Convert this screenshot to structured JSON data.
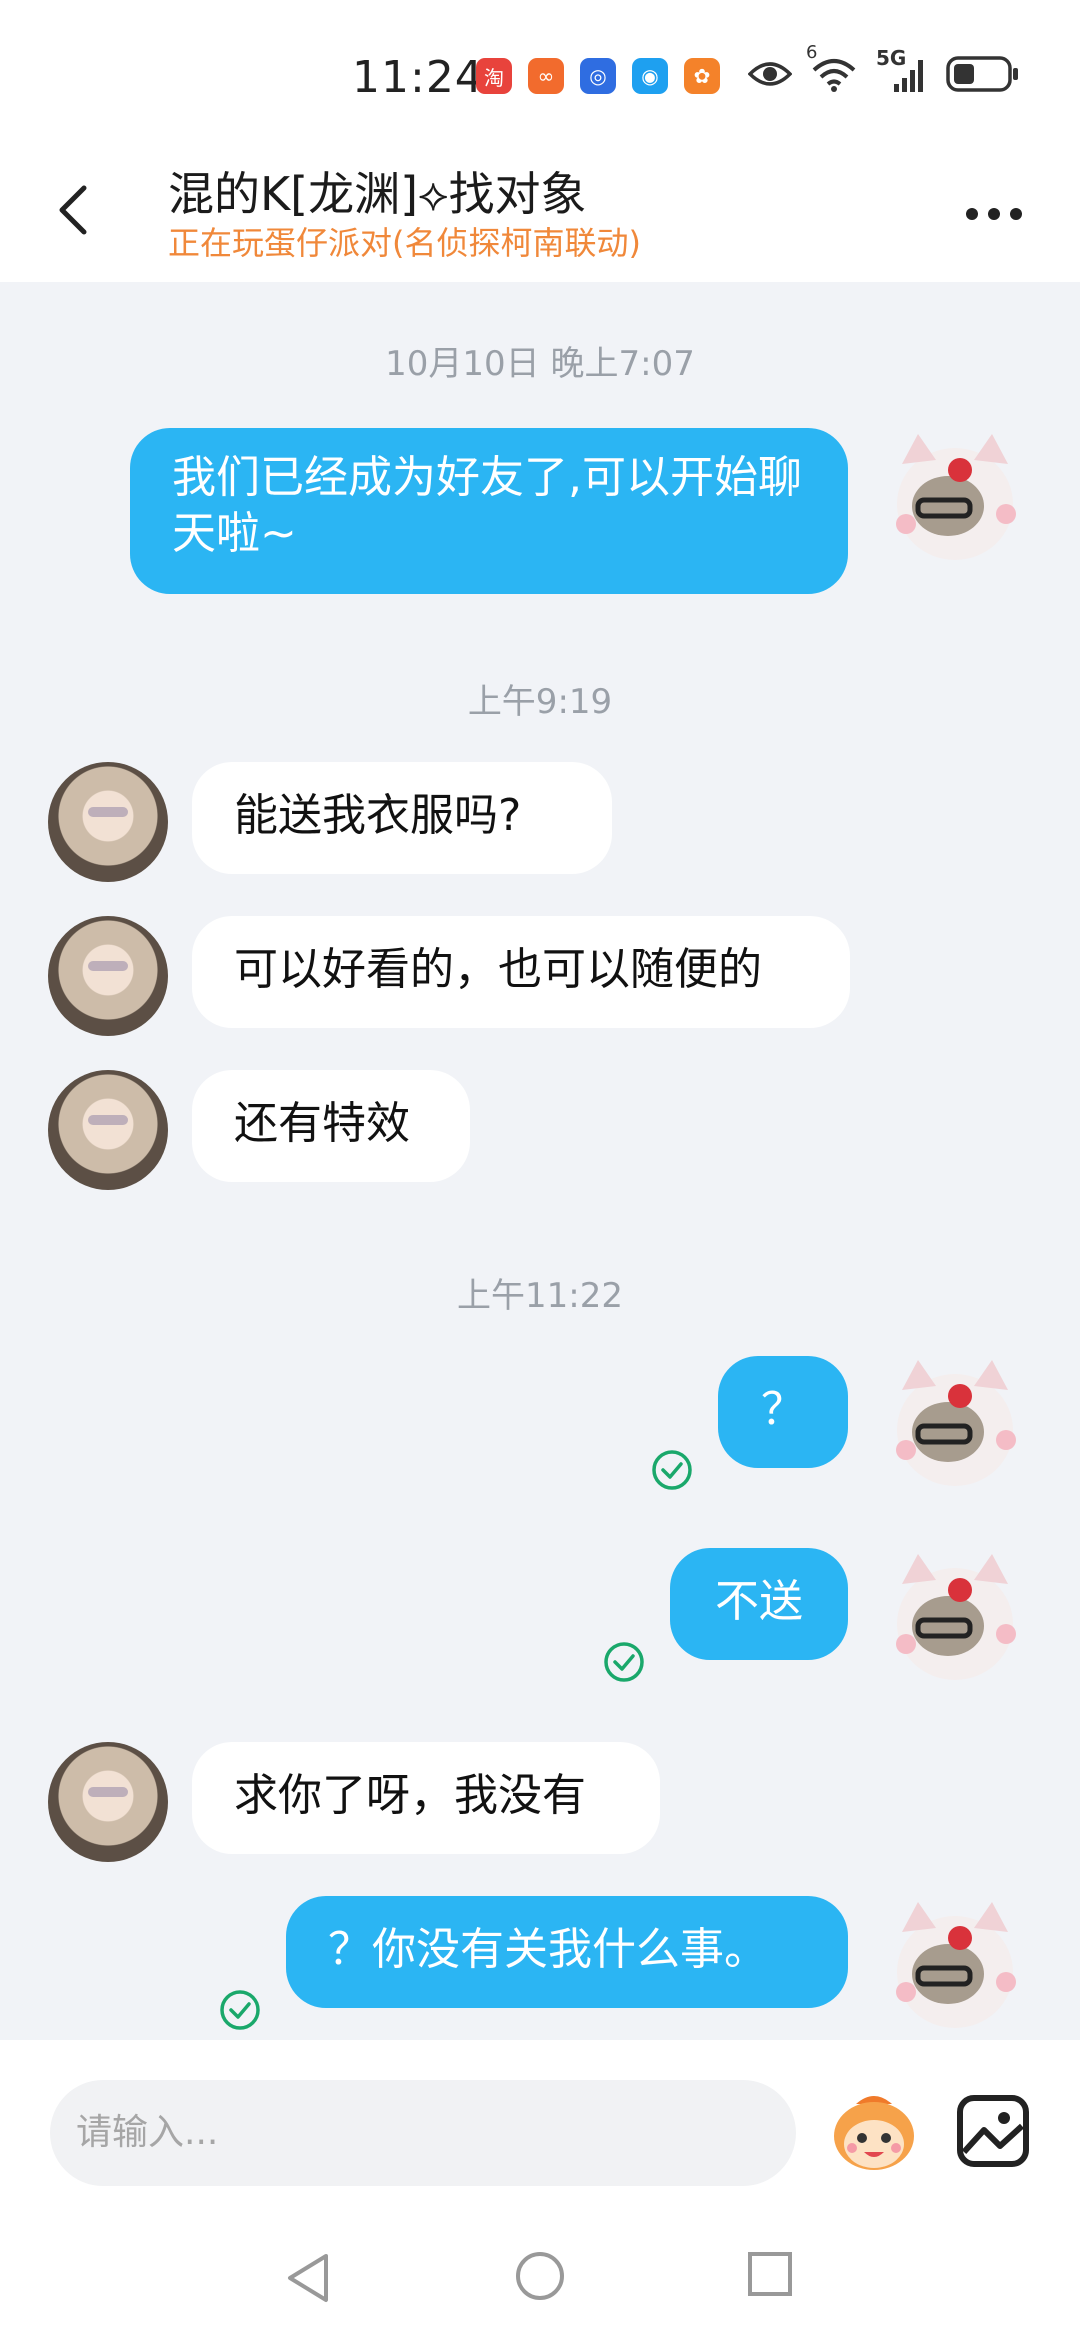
{
  "status_bar": {
    "time": "11:24",
    "app_icons": [
      "taobao-icon",
      "meituan-icon",
      "browser-icon",
      "messages-icon",
      "game-icon"
    ],
    "icons": [
      "eye-icon",
      "wifi-icon",
      "signal-5g-icon",
      "battery-icon"
    ],
    "wifi_label": "6",
    "network_label": "5G"
  },
  "header": {
    "title": "混的K[龙渊]⟡找对象",
    "subtitle": "正在玩蛋仔派对(名侦探柯南联动)",
    "subtitle_color": "#f0883a"
  },
  "messages": {
    "ts1": "10月10日 晚上7:07",
    "m1": "我们已经成为好友了,可以开始聊天啦~",
    "ts2": "上午9:19",
    "m2": "能送我衣服吗?",
    "m3": "可以好看的，也可以随便的",
    "m4": "还有特效",
    "ts3": "上午11:22",
    "m5": "？",
    "m6": "不送",
    "m7": "求你了呀，我没有",
    "m8": "？你没有关我什么事。"
  },
  "colors": {
    "outgoing_bubble": "#2bb5f3",
    "incoming_bubble": "#ffffff",
    "background": "#f1f3f7",
    "sent_check": "#1aa86b"
  },
  "input": {
    "placeholder": "请输入..."
  }
}
